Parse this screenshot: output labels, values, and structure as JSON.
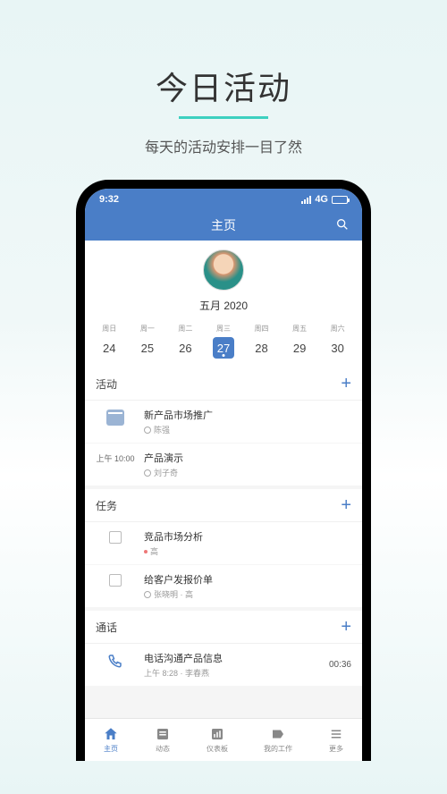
{
  "hero": {
    "title": "今日活动",
    "subtitle": "每天的活动安排一目了然"
  },
  "status": {
    "time": "9:32",
    "network": "4G"
  },
  "header": {
    "title": "主页"
  },
  "profile": {
    "month_year": "五月 2020"
  },
  "calendar": {
    "dow": [
      "周日",
      "周一",
      "周二",
      "周三",
      "周四",
      "周五",
      "周六"
    ],
    "days": [
      "24",
      "25",
      "26",
      "27",
      "28",
      "29",
      "30"
    ],
    "selected_index": 3
  },
  "sections": {
    "activities": {
      "title": "活动",
      "items": [
        {
          "left_type": "calicon",
          "title": "新产品市场推广",
          "meta": "陈强"
        },
        {
          "left_text": "上午 10:00",
          "title": "产品演示",
          "meta": "刘子奇"
        }
      ]
    },
    "tasks": {
      "title": "任务",
      "items": [
        {
          "title": "竞品市场分析",
          "meta": "高"
        },
        {
          "title": "给客户发报价单",
          "meta": "张晓明 · 高"
        }
      ]
    },
    "calls": {
      "title": "通话",
      "items": [
        {
          "title": "电话沟通产品信息",
          "meta": "上午 8:28 · 李春燕",
          "right": "00:36"
        }
      ]
    }
  },
  "nav": {
    "items": [
      {
        "label": "主页"
      },
      {
        "label": "动态"
      },
      {
        "label": "仪表板"
      },
      {
        "label": "我的工作"
      },
      {
        "label": "更多"
      }
    ]
  }
}
